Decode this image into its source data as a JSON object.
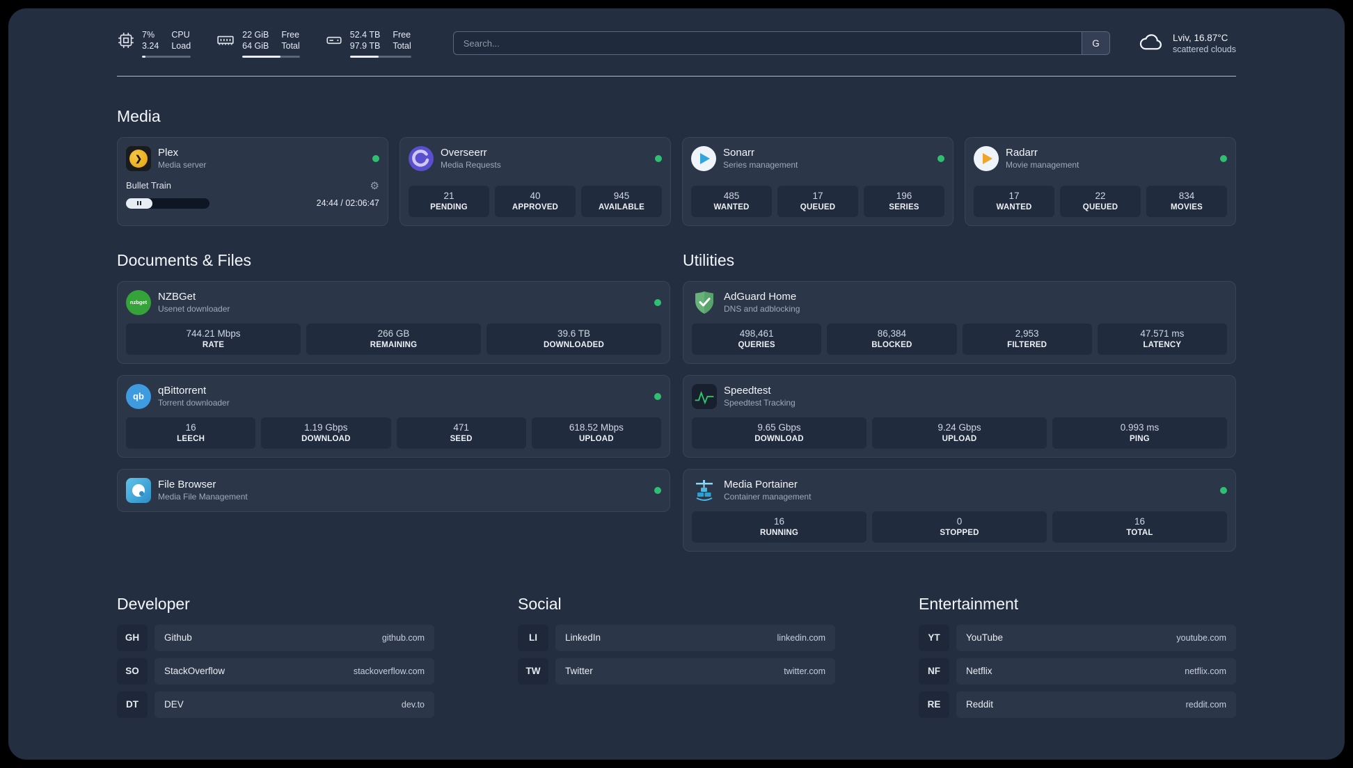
{
  "colors": {
    "online": "#2fbf71"
  },
  "header": {
    "cpu": {
      "percent": "7%",
      "load": "3.24",
      "label1": "CPU",
      "label2": "Load",
      "bar": "7%"
    },
    "ram": {
      "free": "22 GiB",
      "total": "64 GiB",
      "label1": "Free",
      "label2": "Total",
      "bar": "66%"
    },
    "disk": {
      "free": "52.4 TB",
      "total": "97.9 TB",
      "label1": "Free",
      "label2": "Total",
      "bar": "47%"
    },
    "search": {
      "placeholder": "Search...",
      "engine_label": "G"
    },
    "weather": {
      "location": "Lviv, 16.87°C",
      "condition": "scattered clouds"
    }
  },
  "sections": {
    "media": {
      "title": "Media"
    },
    "documents": {
      "title": "Documents & Files"
    },
    "utilities": {
      "title": "Utilities"
    },
    "developer": {
      "title": "Developer"
    },
    "social": {
      "title": "Social"
    },
    "entertainment": {
      "title": "Entertainment"
    }
  },
  "media_apps": {
    "plex": {
      "name": "Plex",
      "subtitle": "Media server",
      "now_playing": "Bullet Train",
      "time": "24:44 / 02:06:47"
    },
    "overseerr": {
      "name": "Overseerr",
      "subtitle": "Media Requests",
      "stats": [
        {
          "value": "21",
          "label": "PENDING"
        },
        {
          "value": "40",
          "label": "APPROVED"
        },
        {
          "value": "945",
          "label": "AVAILABLE"
        }
      ]
    },
    "sonarr": {
      "name": "Sonarr",
      "subtitle": "Series management",
      "stats": [
        {
          "value": "485",
          "label": "WANTED"
        },
        {
          "value": "17",
          "label": "QUEUED"
        },
        {
          "value": "196",
          "label": "SERIES"
        }
      ]
    },
    "radarr": {
      "name": "Radarr",
      "subtitle": "Movie management",
      "stats": [
        {
          "value": "17",
          "label": "WANTED"
        },
        {
          "value": "22",
          "label": "QUEUED"
        },
        {
          "value": "834",
          "label": "MOVIES"
        }
      ]
    }
  },
  "document_apps": {
    "nzbget": {
      "name": "NZBGet",
      "subtitle": "Usenet downloader",
      "icon_text": "nzbget",
      "stats": [
        {
          "value": "744.21 Mbps",
          "label": "RATE"
        },
        {
          "value": "266 GB",
          "label": "REMAINING"
        },
        {
          "value": "39.6 TB",
          "label": "DOWNLOADED"
        }
      ]
    },
    "qbittorrent": {
      "name": "qBittorrent",
      "subtitle": "Torrent downloader",
      "icon_text": "qb",
      "stats": [
        {
          "value": "16",
          "label": "LEECH"
        },
        {
          "value": "1.19 Gbps",
          "label": "DOWNLOAD"
        },
        {
          "value": "471",
          "label": "SEED"
        },
        {
          "value": "618.52 Mbps",
          "label": "UPLOAD"
        }
      ]
    },
    "filebrowser": {
      "name": "File Browser",
      "subtitle": "Media File Management"
    }
  },
  "utility_apps": {
    "adguard": {
      "name": "AdGuard Home",
      "subtitle": "DNS and adblocking",
      "stats": [
        {
          "value": "498,461",
          "label": "QUERIES"
        },
        {
          "value": "86,384",
          "label": "BLOCKED"
        },
        {
          "value": "2,953",
          "label": "FILTERED"
        },
        {
          "value": "47.571 ms",
          "label": "LATENCY"
        }
      ]
    },
    "speedtest": {
      "name": "Speedtest",
      "subtitle": "Speedtest Tracking",
      "stats": [
        {
          "value": "9.65 Gbps",
          "label": "DOWNLOAD"
        },
        {
          "value": "9.24 Gbps",
          "label": "UPLOAD"
        },
        {
          "value": "0.993 ms",
          "label": "PING"
        }
      ]
    },
    "portainer": {
      "name": "Media Portainer",
      "subtitle": "Container management",
      "stats": [
        {
          "value": "16",
          "label": "RUNNING"
        },
        {
          "value": "0",
          "label": "STOPPED"
        },
        {
          "value": "16",
          "label": "TOTAL"
        }
      ]
    }
  },
  "bookmarks": {
    "developer": [
      {
        "abbr": "GH",
        "name": "Github",
        "url": "github.com"
      },
      {
        "abbr": "SO",
        "name": "StackOverflow",
        "url": "stackoverflow.com"
      },
      {
        "abbr": "DT",
        "name": "DEV",
        "url": "dev.to"
      }
    ],
    "social": [
      {
        "abbr": "LI",
        "name": "LinkedIn",
        "url": "linkedin.com"
      },
      {
        "abbr": "TW",
        "name": "Twitter",
        "url": "twitter.com"
      }
    ],
    "entertainment": [
      {
        "abbr": "YT",
        "name": "YouTube",
        "url": "youtube.com"
      },
      {
        "abbr": "NF",
        "name": "Netflix",
        "url": "netflix.com"
      },
      {
        "abbr": "RE",
        "name": "Reddit",
        "url": "reddit.com"
      }
    ]
  }
}
